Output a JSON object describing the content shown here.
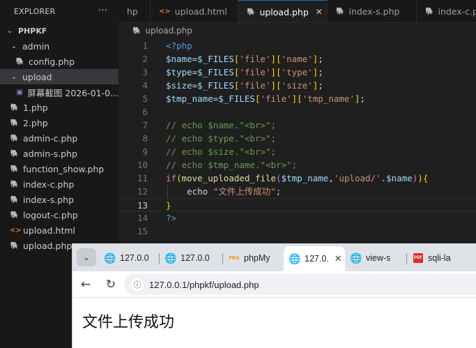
{
  "explorer": {
    "title": "EXPLORER",
    "more": "···",
    "items": [
      {
        "label": "PHPKF",
        "chevron": "⌄",
        "bold": true
      },
      {
        "label": "admin",
        "chevron": "⌄"
      },
      {
        "label": "config.php",
        "icon": "php-elephant-icon"
      },
      {
        "label": "upload",
        "chevron": "⌄"
      },
      {
        "label": "屏幕截图 2026-01-0...",
        "icon": "image-file-icon"
      },
      {
        "label": "1.php",
        "icon": "php-elephant-icon"
      },
      {
        "label": "2.php",
        "icon": "php-elephant-icon"
      },
      {
        "label": "admin-c.php",
        "icon": "php-elephant-icon"
      },
      {
        "label": "admin-s.php",
        "icon": "php-elephant-icon"
      },
      {
        "label": "function_show.php",
        "icon": "php-elephant-icon"
      },
      {
        "label": "index-c.php",
        "icon": "php-elephant-icon"
      },
      {
        "label": "index-s.php",
        "icon": "php-elephant-icon"
      },
      {
        "label": "logout-c.php",
        "icon": "php-elephant-icon"
      },
      {
        "label": "upload.html",
        "icon": "html-brackets-icon"
      },
      {
        "label": "upload.php",
        "icon": "php-elephant-icon"
      }
    ]
  },
  "editor_tabs": [
    {
      "label": "hp",
      "icon": ""
    },
    {
      "label": "upload.html",
      "icon": "html-brackets-icon"
    },
    {
      "label": "upload.php",
      "icon": "php-elephant-icon",
      "active": true,
      "close": "✕"
    },
    {
      "label": "index-s.php",
      "icon": "php-elephant-icon"
    },
    {
      "label": "index-c.p",
      "icon": "php-elephant-icon"
    }
  ],
  "breadcrumb": {
    "file": "upload.php"
  },
  "code": {
    "active_line": 13,
    "lines": [
      {
        "n": "1",
        "t": [
          [
            "k-tag",
            "<?php"
          ]
        ]
      },
      {
        "n": "2",
        "t": [
          [
            "k-var",
            "$name"
          ],
          [
            "k-op",
            "="
          ],
          [
            "k-var",
            "$_FILES"
          ],
          [
            "k-br1",
            "["
          ],
          [
            "k-str",
            "'file'"
          ],
          [
            "k-br1",
            "]["
          ],
          [
            "k-str",
            "'name'"
          ],
          [
            "k-br1",
            "]"
          ],
          [
            "k-op",
            ";"
          ]
        ]
      },
      {
        "n": "3",
        "t": [
          [
            "k-var",
            "$type"
          ],
          [
            "k-op",
            "="
          ],
          [
            "k-var",
            "$_FILES"
          ],
          [
            "k-br1",
            "["
          ],
          [
            "k-str",
            "'file'"
          ],
          [
            "k-br1",
            "]["
          ],
          [
            "k-str",
            "'type'"
          ],
          [
            "k-br1",
            "]"
          ],
          [
            "k-op",
            ";"
          ]
        ]
      },
      {
        "n": "4",
        "t": [
          [
            "k-var",
            "$size"
          ],
          [
            "k-op",
            "="
          ],
          [
            "k-var",
            "$_FILES"
          ],
          [
            "k-br1",
            "["
          ],
          [
            "k-str",
            "'file'"
          ],
          [
            "k-br1",
            "]["
          ],
          [
            "k-str",
            "'size'"
          ],
          [
            "k-br1",
            "]"
          ],
          [
            "k-op",
            ";"
          ]
        ]
      },
      {
        "n": "5",
        "t": [
          [
            "k-var",
            "$tmp_name"
          ],
          [
            "k-op",
            "="
          ],
          [
            "k-var",
            "$_FILES"
          ],
          [
            "k-br1",
            "["
          ],
          [
            "k-str",
            "'file'"
          ],
          [
            "k-br1",
            "]["
          ],
          [
            "k-str",
            "'tmp_name'"
          ],
          [
            "k-br1",
            "]"
          ],
          [
            "k-op",
            ";"
          ]
        ]
      },
      {
        "n": "6",
        "t": []
      },
      {
        "n": "7",
        "t": [
          [
            "k-cmt",
            "// echo $name.\"<br>\";"
          ]
        ]
      },
      {
        "n": "8",
        "t": [
          [
            "k-cmt",
            "// echo $type.\"<br>\";"
          ]
        ]
      },
      {
        "n": "9",
        "t": [
          [
            "k-cmt",
            "// echo $size.\"<br>\";"
          ]
        ]
      },
      {
        "n": "10",
        "t": [
          [
            "k-cmt",
            "// echo $tmp_name.\"<br>\";"
          ]
        ]
      },
      {
        "n": "11",
        "t": [
          [
            "k-kw",
            "if"
          ],
          [
            "k-br1",
            "("
          ],
          [
            "k-fn",
            "move_uploaded_file"
          ],
          [
            "k-br2",
            "("
          ],
          [
            "k-var",
            "$tmp_name"
          ],
          [
            "k-op",
            ","
          ],
          [
            "k-str",
            "'upload/'"
          ],
          [
            "k-op",
            "."
          ],
          [
            "k-var",
            "$name"
          ],
          [
            "k-br2",
            ")"
          ],
          [
            "k-br1",
            ")"
          ],
          [
            "k-br1",
            "{"
          ]
        ]
      },
      {
        "n": "12",
        "t": [
          [
            "k-plain",
            "    echo "
          ],
          [
            "k-str",
            "\"文件上传成功\""
          ],
          [
            "k-op",
            ";"
          ]
        ],
        "guide": true
      },
      {
        "n": "13",
        "t": [
          [
            "k-br1",
            "}"
          ]
        ]
      },
      {
        "n": "14",
        "t": [
          [
            "k-tag",
            "?>"
          ]
        ]
      },
      {
        "n": "15",
        "t": []
      }
    ]
  },
  "browser": {
    "tabs": [
      {
        "label": "127.0.0",
        "icon": "globe-icon"
      },
      {
        "label": "127.0.0",
        "icon": "globe-icon"
      },
      {
        "label": "phpMy",
        "icon": "phpmyadmin-icon"
      },
      {
        "label": "127.0.",
        "icon": "globe-icon",
        "active": true,
        "close": "✕"
      },
      {
        "label": "view-s",
        "icon": "globe-icon"
      },
      {
        "label": "sqli-la",
        "icon": "pdf-icon"
      }
    ],
    "url": "127.0.0.1/phpkf/upload.php",
    "page_text": "文件上传成功"
  }
}
